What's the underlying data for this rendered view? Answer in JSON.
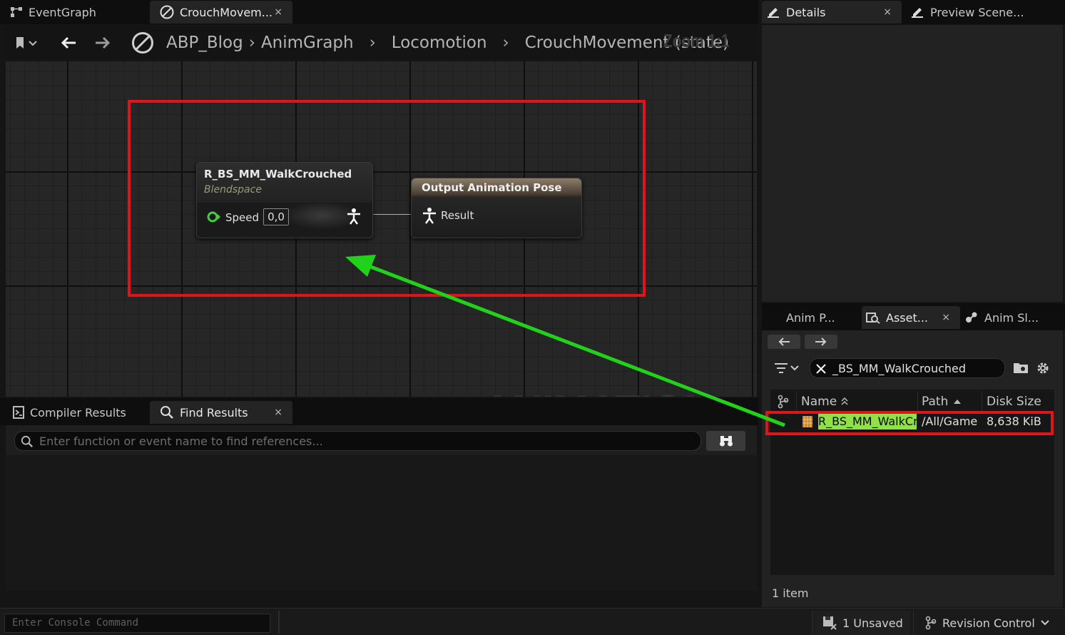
{
  "graph_tabs": [
    {
      "label": "EventGraph"
    },
    {
      "label": "CrouchMovem...",
      "close": "×"
    }
  ],
  "breadcrumb": {
    "items": [
      "ABP_Blog",
      "AnimGraph",
      "Locomotion",
      "CrouchMovement (state)"
    ],
    "zoom": "Zoom 1:1"
  },
  "blendspace_node": {
    "title": "R_BS_MM_WalkCrouched",
    "subtitle": "Blendspace",
    "pin_label": "Speed",
    "pin_value": "0,0"
  },
  "output_node": {
    "title": "Output Animation Pose",
    "pin_label": "Result"
  },
  "watermark": "ANIMATION",
  "bottom_tabs": [
    {
      "label": "Compiler Results"
    },
    {
      "label": "Find Results",
      "close": "×"
    }
  ],
  "find": {
    "placeholder": "Enter function or event name to find references..."
  },
  "console": {
    "placeholder": "Enter Console Command"
  },
  "right_tabs": [
    {
      "label": "Details",
      "close": "×"
    },
    {
      "label": "Preview Scene..."
    }
  ],
  "asset_tabs": [
    {
      "label": "Anim P..."
    },
    {
      "label": "Asset...",
      "close": "×"
    },
    {
      "label": "Anim Sl..."
    }
  ],
  "asset_browser": {
    "search_value": "_BS_MM_WalkCrouched",
    "columns": [
      "Name",
      "Path",
      "Disk Size"
    ],
    "rows": [
      {
        "name": "R_BS_MM_WalkCr",
        "path": "/All/Game",
        "size": "8,638 KiB"
      }
    ],
    "count": "1 item"
  },
  "status_bar": {
    "unsaved": "1 Unsaved",
    "revision": "Revision Control"
  },
  "colors": {
    "highlight_red": "#e0141b",
    "arrow_green": "#22d11a",
    "selected_green": "#8fe04a"
  },
  "icons": [
    "graph-icon",
    "anim-state-icon",
    "close-icon",
    "bookmark-icon",
    "back-arrow-icon",
    "forward-arrow-icon",
    "compiler-icon",
    "search-icon",
    "binoculars-icon",
    "details-icon",
    "preview-scene-icon",
    "filter-icon",
    "folder-icon",
    "gear-icon",
    "asset-icon",
    "save-icon",
    "revision-icon"
  ]
}
